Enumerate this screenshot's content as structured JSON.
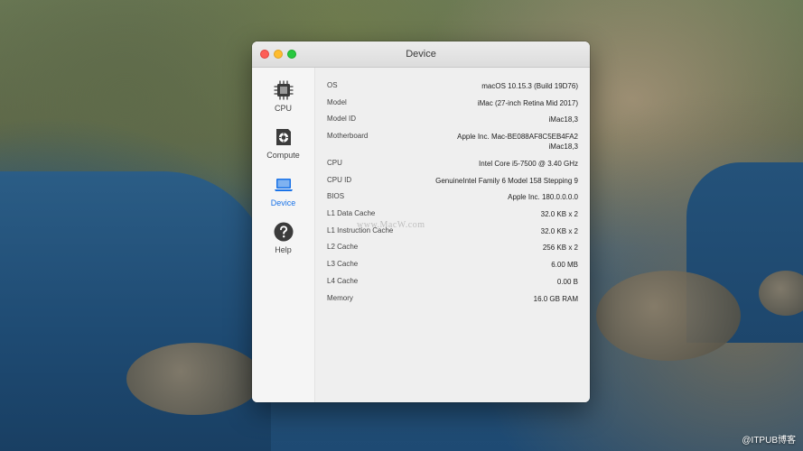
{
  "window": {
    "title": "Device"
  },
  "sidebar": {
    "items": [
      {
        "label": "CPU",
        "icon": "cpu-chip-icon"
      },
      {
        "label": "Compute",
        "icon": "compute-card-icon"
      },
      {
        "label": "Device",
        "icon": "laptop-icon",
        "active": true
      },
      {
        "label": "Help",
        "icon": "help-question-icon"
      }
    ]
  },
  "device_info": {
    "rows": [
      {
        "label": "OS",
        "value": "macOS 10.15.3 (Build 19D76)"
      },
      {
        "label": "Model",
        "value": "iMac (27-inch Retina Mid 2017)"
      },
      {
        "label": "Model ID",
        "value": "iMac18,3"
      },
      {
        "label": "Motherboard",
        "value": "Apple Inc. Mac-BE088AF8C5EB4FA2",
        "value2": "iMac18,3"
      },
      {
        "label": "CPU",
        "value": "Intel Core i5-7500 @ 3.40 GHz"
      },
      {
        "label": "CPU ID",
        "value": "GenuineIntel Family 6 Model 158 Stepping 9"
      },
      {
        "label": "BIOS",
        "value": "Apple Inc. 180.0.0.0.0"
      },
      {
        "label": "L1 Data Cache",
        "value": "32.0 KB x 2"
      },
      {
        "label": "L1 Instruction Cache",
        "value": "32.0 KB x 2"
      },
      {
        "label": "L2 Cache",
        "value": "256 KB x 2"
      },
      {
        "label": "L3 Cache",
        "value": "6.00 MB"
      },
      {
        "label": "L4 Cache",
        "value": "0.00 B"
      },
      {
        "label": "Memory",
        "value": "16.0 GB RAM"
      }
    ]
  },
  "watermark": "www.MacW.com",
  "corner_watermark": "@ITPUB博客",
  "colors": {
    "accent": "#1a73e8",
    "close": "#fd5f57",
    "minimize": "#febc2e",
    "zoom": "#28c840"
  }
}
